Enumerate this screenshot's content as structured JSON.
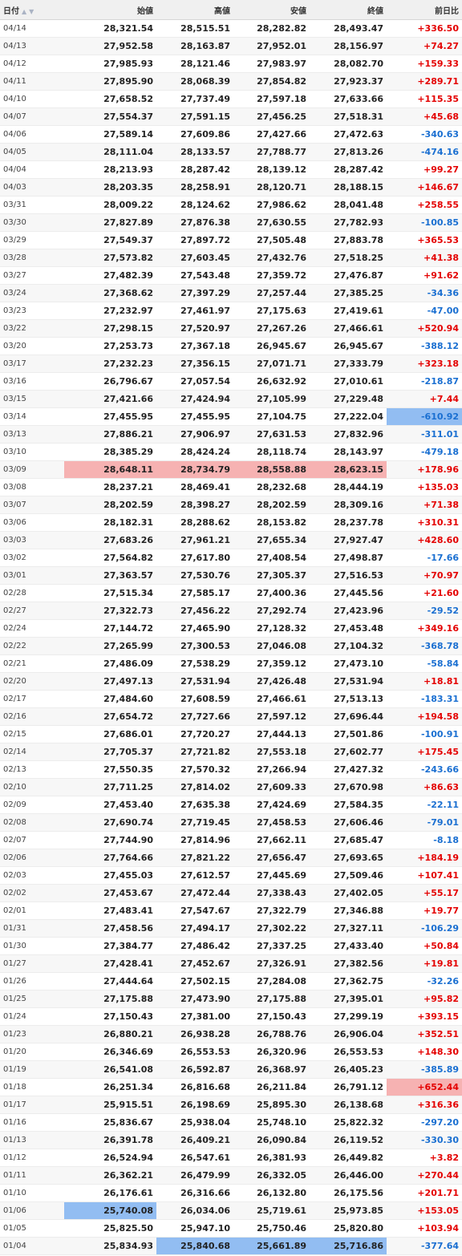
{
  "headers": {
    "date": "日付",
    "open": "始値",
    "high": "高値",
    "low": "安値",
    "close": "終値",
    "change": "前日比"
  },
  "colors": {
    "up": "#e40000",
    "down": "#1a6fd1",
    "highlight_max": "#f6b2b2",
    "highlight_min": "#92bdf2"
  },
  "rows": [
    [
      "04/14",
      "28,321.54",
      "28,515.51",
      "28,282.82",
      "28,493.47",
      "+336.50"
    ],
    [
      "04/13",
      "27,952.58",
      "28,163.87",
      "27,952.01",
      "28,156.97",
      "+74.27"
    ],
    [
      "04/12",
      "27,985.93",
      "28,121.46",
      "27,983.97",
      "28,082.70",
      "+159.33"
    ],
    [
      "04/11",
      "27,895.90",
      "28,068.39",
      "27,854.82",
      "27,923.37",
      "+289.71"
    ],
    [
      "04/10",
      "27,658.52",
      "27,737.49",
      "27,597.18",
      "27,633.66",
      "+115.35"
    ],
    [
      "04/07",
      "27,554.37",
      "27,591.15",
      "27,456.25",
      "27,518.31",
      "+45.68"
    ],
    [
      "04/06",
      "27,589.14",
      "27,609.86",
      "27,427.66",
      "27,472.63",
      "-340.63"
    ],
    [
      "04/05",
      "28,111.04",
      "28,133.57",
      "27,788.77",
      "27,813.26",
      "-474.16"
    ],
    [
      "04/04",
      "28,213.93",
      "28,287.42",
      "28,139.12",
      "28,287.42",
      "+99.27"
    ],
    [
      "04/03",
      "28,203.35",
      "28,258.91",
      "28,120.71",
      "28,188.15",
      "+146.67"
    ],
    [
      "03/31",
      "28,009.22",
      "28,124.62",
      "27,986.62",
      "28,041.48",
      "+258.55"
    ],
    [
      "03/30",
      "27,827.89",
      "27,876.38",
      "27,630.55",
      "27,782.93",
      "-100.85"
    ],
    [
      "03/29",
      "27,549.37",
      "27,897.72",
      "27,505.48",
      "27,883.78",
      "+365.53"
    ],
    [
      "03/28",
      "27,573.82",
      "27,603.45",
      "27,432.76",
      "27,518.25",
      "+41.38"
    ],
    [
      "03/27",
      "27,482.39",
      "27,543.48",
      "27,359.72",
      "27,476.87",
      "+91.62"
    ],
    [
      "03/24",
      "27,368.62",
      "27,397.29",
      "27,257.44",
      "27,385.25",
      "-34.36"
    ],
    [
      "03/23",
      "27,232.97",
      "27,461.97",
      "27,175.63",
      "27,419.61",
      "-47.00"
    ],
    [
      "03/22",
      "27,298.15",
      "27,520.97",
      "27,267.26",
      "27,466.61",
      "+520.94"
    ],
    [
      "03/20",
      "27,253.73",
      "27,367.18",
      "26,945.67",
      "26,945.67",
      "-388.12"
    ],
    [
      "03/17",
      "27,232.23",
      "27,356.15",
      "27,071.71",
      "27,333.79",
      "+323.18"
    ],
    [
      "03/16",
      "26,796.67",
      "27,057.54",
      "26,632.92",
      "27,010.61",
      "-218.87"
    ],
    [
      "03/15",
      "27,421.66",
      "27,424.94",
      "27,105.99",
      "27,229.48",
      "+7.44"
    ],
    [
      "03/14",
      "27,455.95",
      "27,455.95",
      "27,104.75",
      "27,222.04",
      "-610.92"
    ],
    [
      "03/13",
      "27,886.21",
      "27,906.97",
      "27,631.53",
      "27,832.96",
      "-311.01"
    ],
    [
      "03/10",
      "28,385.29",
      "28,424.24",
      "28,118.74",
      "28,143.97",
      "-479.18"
    ],
    [
      "03/09",
      "28,648.11",
      "28,734.79",
      "28,558.88",
      "28,623.15",
      "+178.96"
    ],
    [
      "03/08",
      "28,237.21",
      "28,469.41",
      "28,232.68",
      "28,444.19",
      "+135.03"
    ],
    [
      "03/07",
      "28,202.59",
      "28,398.27",
      "28,202.59",
      "28,309.16",
      "+71.38"
    ],
    [
      "03/06",
      "28,182.31",
      "28,288.62",
      "28,153.82",
      "28,237.78",
      "+310.31"
    ],
    [
      "03/03",
      "27,683.26",
      "27,961.21",
      "27,655.34",
      "27,927.47",
      "+428.60"
    ],
    [
      "03/02",
      "27,564.82",
      "27,617.80",
      "27,408.54",
      "27,498.87",
      "-17.66"
    ],
    [
      "03/01",
      "27,363.57",
      "27,530.76",
      "27,305.37",
      "27,516.53",
      "+70.97"
    ],
    [
      "02/28",
      "27,515.34",
      "27,585.17",
      "27,400.36",
      "27,445.56",
      "+21.60"
    ],
    [
      "02/27",
      "27,322.73",
      "27,456.22",
      "27,292.74",
      "27,423.96",
      "-29.52"
    ],
    [
      "02/24",
      "27,144.72",
      "27,465.90",
      "27,128.32",
      "27,453.48",
      "+349.16"
    ],
    [
      "02/22",
      "27,265.99",
      "27,300.53",
      "27,046.08",
      "27,104.32",
      "-368.78"
    ],
    [
      "02/21",
      "27,486.09",
      "27,538.29",
      "27,359.12",
      "27,473.10",
      "-58.84"
    ],
    [
      "02/20",
      "27,497.13",
      "27,531.94",
      "27,426.48",
      "27,531.94",
      "+18.81"
    ],
    [
      "02/17",
      "27,484.60",
      "27,608.59",
      "27,466.61",
      "27,513.13",
      "-183.31"
    ],
    [
      "02/16",
      "27,654.72",
      "27,727.66",
      "27,597.12",
      "27,696.44",
      "+194.58"
    ],
    [
      "02/15",
      "27,686.01",
      "27,720.27",
      "27,444.13",
      "27,501.86",
      "-100.91"
    ],
    [
      "02/14",
      "27,705.37",
      "27,721.82",
      "27,553.18",
      "27,602.77",
      "+175.45"
    ],
    [
      "02/13",
      "27,550.35",
      "27,570.32",
      "27,266.94",
      "27,427.32",
      "-243.66"
    ],
    [
      "02/10",
      "27,711.25",
      "27,814.02",
      "27,609.33",
      "27,670.98",
      "+86.63"
    ],
    [
      "02/09",
      "27,453.40",
      "27,635.38",
      "27,424.69",
      "27,584.35",
      "-22.11"
    ],
    [
      "02/08",
      "27,690.74",
      "27,719.45",
      "27,458.53",
      "27,606.46",
      "-79.01"
    ],
    [
      "02/07",
      "27,744.90",
      "27,814.96",
      "27,662.11",
      "27,685.47",
      "-8.18"
    ],
    [
      "02/06",
      "27,764.66",
      "27,821.22",
      "27,656.47",
      "27,693.65",
      "+184.19"
    ],
    [
      "02/03",
      "27,455.03",
      "27,612.57",
      "27,445.69",
      "27,509.46",
      "+107.41"
    ],
    [
      "02/02",
      "27,453.67",
      "27,472.44",
      "27,338.43",
      "27,402.05",
      "+55.17"
    ],
    [
      "02/01",
      "27,483.41",
      "27,547.67",
      "27,322.79",
      "27,346.88",
      "+19.77"
    ],
    [
      "01/31",
      "27,458.56",
      "27,494.17",
      "27,302.22",
      "27,327.11",
      "-106.29"
    ],
    [
      "01/30",
      "27,384.77",
      "27,486.42",
      "27,337.25",
      "27,433.40",
      "+50.84"
    ],
    [
      "01/27",
      "27,428.41",
      "27,452.67",
      "27,326.91",
      "27,382.56",
      "+19.81"
    ],
    [
      "01/26",
      "27,444.64",
      "27,502.15",
      "27,284.08",
      "27,362.75",
      "-32.26"
    ],
    [
      "01/25",
      "27,175.88",
      "27,473.90",
      "27,175.88",
      "27,395.01",
      "+95.82"
    ],
    [
      "01/24",
      "27,150.43",
      "27,381.00",
      "27,150.43",
      "27,299.19",
      "+393.15"
    ],
    [
      "01/23",
      "26,880.21",
      "26,938.28",
      "26,788.76",
      "26,906.04",
      "+352.51"
    ],
    [
      "01/20",
      "26,346.69",
      "26,553.53",
      "26,320.96",
      "26,553.53",
      "+148.30"
    ],
    [
      "01/19",
      "26,541.08",
      "26,592.87",
      "26,368.97",
      "26,405.23",
      "-385.89"
    ],
    [
      "01/18",
      "26,251.34",
      "26,816.68",
      "26,211.84",
      "26,791.12",
      "+652.44"
    ],
    [
      "01/17",
      "25,915.51",
      "26,198.69",
      "25,895.30",
      "26,138.68",
      "+316.36"
    ],
    [
      "01/16",
      "25,836.67",
      "25,938.04",
      "25,748.10",
      "25,822.32",
      "-297.20"
    ],
    [
      "01/13",
      "26,391.78",
      "26,409.21",
      "26,090.84",
      "26,119.52",
      "-330.30"
    ],
    [
      "01/12",
      "26,524.94",
      "26,547.61",
      "26,381.93",
      "26,449.82",
      "+3.82"
    ],
    [
      "01/11",
      "26,362.21",
      "26,479.99",
      "26,332.05",
      "26,446.00",
      "+270.44"
    ],
    [
      "01/10",
      "26,176.61",
      "26,316.66",
      "26,132.80",
      "26,175.56",
      "+201.71"
    ],
    [
      "01/06",
      "25,740.08",
      "26,034.06",
      "25,719.61",
      "25,973.85",
      "+153.05"
    ],
    [
      "01/05",
      "25,825.50",
      "25,947.10",
      "25,750.46",
      "25,820.80",
      "+103.94"
    ],
    [
      "01/04",
      "25,834.93",
      "25,840.68",
      "25,661.89",
      "25,716.86",
      "-377.64"
    ]
  ],
  "highlights": {
    "max": {
      "03/09": [
        1,
        2,
        3,
        4
      ],
      "01/18": [
        5
      ]
    },
    "min": {
      "03/14": [
        5
      ],
      "01/06": [
        1
      ],
      "01/04": [
        2,
        3,
        4
      ]
    }
  }
}
